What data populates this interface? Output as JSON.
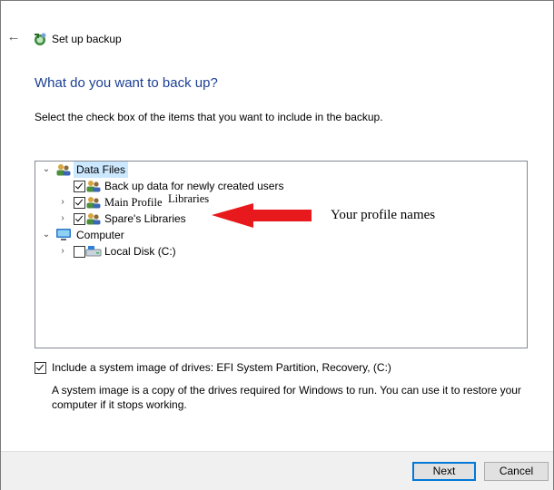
{
  "header": {
    "title": "Set up backup",
    "back_icon": "back-arrow-icon",
    "app_icon": "backup-icon"
  },
  "main": {
    "heading": "What do you want to back up?",
    "instruction": "Select the check box of the items that you want to include in the backup."
  },
  "tree": {
    "items": [
      {
        "label": "Data Files",
        "expanded": true,
        "checked": null,
        "icon": "users-icon"
      },
      {
        "label": "Back up data for newly created users",
        "checked": true,
        "icon": "users-icon"
      },
      {
        "label_a": "Main Profile",
        "label_b": "Libraries",
        "expanded": false,
        "checked": true,
        "icon": "users-icon"
      },
      {
        "label": "Spare's Libraries",
        "expanded": false,
        "checked": true,
        "icon": "users-icon"
      },
      {
        "label": "Computer",
        "expanded": true,
        "checked": null,
        "icon": "computer-icon"
      },
      {
        "label": "Local Disk (C:)",
        "expanded": false,
        "checked": false,
        "icon": "disk-icon"
      }
    ]
  },
  "annotation": {
    "text": "Your profile names",
    "arrow_color": "#e8191c"
  },
  "system_image": {
    "checked": true,
    "label": "Include a system image of drives: EFI System Partition, Recovery, (C:)",
    "description": "A system image is a copy of the drives required for Windows to run. You can use it to restore your computer if it stops working."
  },
  "footer": {
    "next_label": "Next",
    "cancel_label": "Cancel"
  },
  "colors": {
    "heading": "#1c3f94",
    "selection": "#cce8ff",
    "default_button_border": "#0078d7"
  }
}
